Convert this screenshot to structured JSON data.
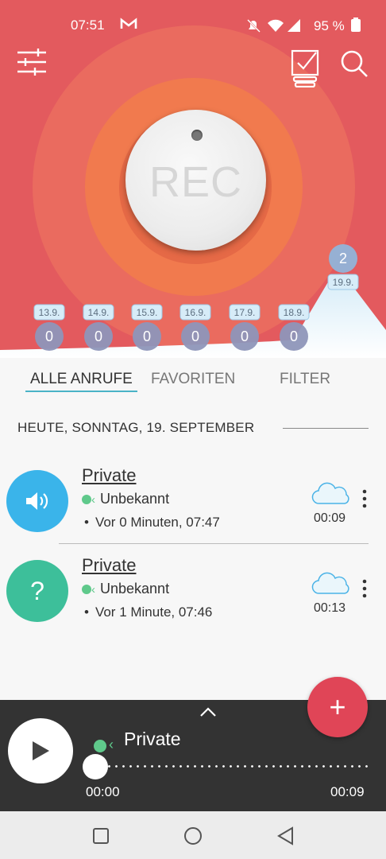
{
  "status_bar": {
    "time": "07:51",
    "mail_icon": "gmail-icon",
    "battery": "95 %"
  },
  "toolbar": {
    "settings_icon": "sliders-icon",
    "tasks_icon": "checklist-icon",
    "search_icon": "search-icon"
  },
  "record_button": {
    "label": "REC"
  },
  "colors": {
    "hero_bg": "#e35a5e",
    "outer_ring": "#ea6b5f",
    "inner_ring": "#f17a4e",
    "accent": "#4ab3c7",
    "fab": "#e04557",
    "avatar_blue": "#3ab4ea",
    "avatar_green": "#3dbf9a",
    "status_green": "#5fc98b"
  },
  "chart_data": {
    "type": "area",
    "categories": [
      "13.9.",
      "14.9.",
      "15.9.",
      "16.9.",
      "17.9.",
      "18.9.",
      "19.9."
    ],
    "values": [
      0,
      0,
      0,
      0,
      0,
      0,
      2
    ]
  },
  "tabs": [
    {
      "label": "ALLE ANRUFE",
      "active": true
    },
    {
      "label": "FAVORITEN",
      "active": false
    },
    {
      "label": "FILTER",
      "active": false
    }
  ],
  "section_header": "HEUTE, SONNTAG, 19. SEPTEMBER",
  "calls": [
    {
      "name": "Private",
      "status": "Unbekannt",
      "time": "Vor 0 Minuten, 07:47",
      "duration": "00:09",
      "avatar_icon": "speaker-icon"
    },
    {
      "name": "Private",
      "status": "Unbekannt",
      "time": "Vor 1 Minute, 07:46",
      "duration": "00:13",
      "avatar_icon": "question-icon",
      "avatar_text": "?"
    }
  ],
  "player": {
    "name": "Private",
    "position": "00:00",
    "duration": "00:09",
    "progress": 0
  },
  "fab_label": "+"
}
